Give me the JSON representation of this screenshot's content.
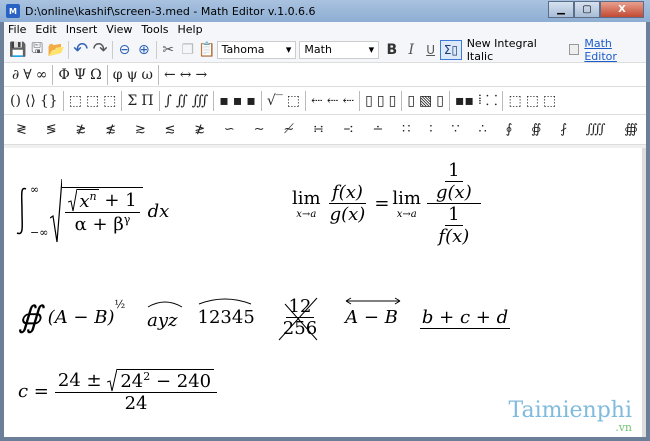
{
  "window": {
    "title": "D:\\online\\kashif\\screen-3.med - Math Editor v.1.0.6.6",
    "minimize": "▁",
    "maximize": "▢",
    "close": "X",
    "icon": "M"
  },
  "menu": [
    "File",
    "Edit",
    "Insert",
    "View",
    "Tools",
    "Help"
  ],
  "toolbar": {
    "icons": [
      "save-icon",
      "save-as-icon",
      "open-icon",
      "undo-icon",
      "redo-icon",
      "zoom-out-icon",
      "zoom-in-icon",
      "cut-icon",
      "copy-icon",
      "paste-icon"
    ],
    "glyphs": [
      "💾",
      "🖫",
      "📂",
      "↶",
      "↷",
      "⊖",
      "⊕",
      "✂",
      "❐",
      "📋"
    ],
    "font": "Tahoma",
    "style": "Math",
    "bold": "B",
    "italic": "I",
    "underline": "U",
    "sigma": "Σ▯",
    "integral_label": "New Integral Italic",
    "link": "Math Editor"
  },
  "palette1": [
    [
      "∂",
      "∀",
      "∞"
    ],
    [
      "Φ",
      "Ψ",
      "Ω"
    ],
    [
      "φ",
      "ψ",
      "ω"
    ],
    [
      "←",
      "↔",
      "→"
    ]
  ],
  "palette2": [
    [
      "()",
      "⟨⟩",
      "{}"
    ],
    [
      "⬚",
      "⬚",
      "⬚"
    ],
    [
      "Σ",
      "Π"
    ],
    [
      "∫",
      "∬",
      "∭"
    ],
    [
      "▪",
      "▪",
      "▪"
    ],
    [
      "√‾",
      "⬚"
    ],
    [
      "⇠",
      "⇠",
      "⇠"
    ],
    [
      "▯",
      "▯",
      "▯"
    ],
    [
      "▯",
      "▧",
      "▯"
    ],
    [
      "▪▪",
      "⁞",
      "⸬"
    ],
    [
      "⬚",
      "⬚",
      "⬚"
    ]
  ],
  "palette3": [
    "≷",
    "≶",
    "≵",
    "≴",
    "≳",
    "≲",
    "≵",
    "∽",
    "∼",
    "≁",
    "∺",
    "∹",
    "∸",
    "∷",
    "∶",
    "∵",
    "∴",
    "∮",
    "∯",
    "⨏",
    "⨌",
    "∰"
  ],
  "formulas": {
    "f1": {
      "lower": "−∞",
      "upper": "∞",
      "num_rad": "x",
      "num_exp": "n",
      "num_plus": "+ 1",
      "den": "α + β",
      "den_exp": "γ",
      "dx": "dx"
    },
    "f2": {
      "lim": "lim",
      "sub": "x→a",
      "fx": "f(x)",
      "gx": "g(x)",
      "eq": "=",
      "one": "1"
    },
    "f3": {
      "oint": "∯",
      "expr": "(A − B)",
      "exp": "½",
      "ayz": "ayz",
      "n12345": "12345",
      "num": "12",
      "den": "256",
      "ab": "A − B",
      "bcd": "b + c + d"
    },
    "f4": {
      "c": "c =",
      "num_a": "24 ±",
      "rad": "24",
      "rad_exp": "2",
      "rad_rest": " − 240",
      "den": "24"
    }
  },
  "watermark": {
    "brand": "Taimienphi",
    "tld": ".vn"
  }
}
